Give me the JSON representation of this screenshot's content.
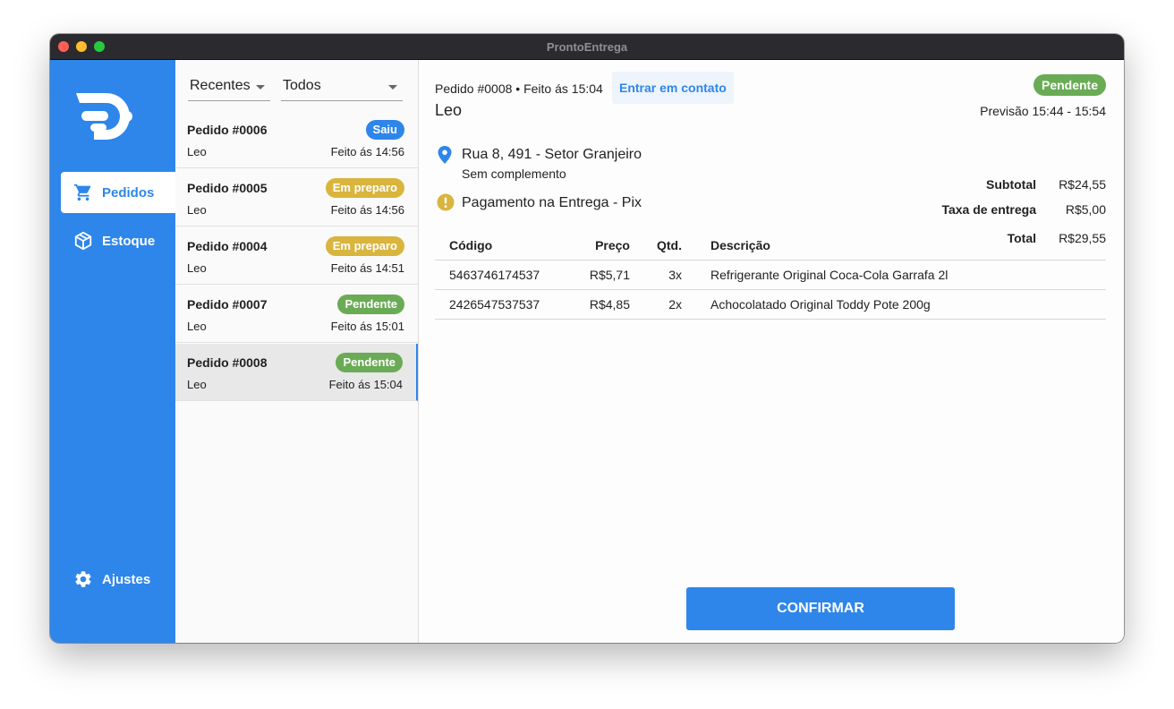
{
  "window": {
    "title": "ProntoEntrega"
  },
  "colors": {
    "brand": "#2e86ea",
    "pendente": "#6aab55",
    "em_preparo": "#d9b53e",
    "saiu": "#2e86ea"
  },
  "sidebar": {
    "logo": "prontoentrega-logo",
    "items": [
      {
        "label": "Pedidos",
        "icon": "cart-icon",
        "active": true
      },
      {
        "label": "Estoque",
        "icon": "box-icon",
        "active": false
      },
      {
        "label": "Ajustes",
        "icon": "gear-icon",
        "active": false
      }
    ]
  },
  "orders": {
    "filters": [
      "Recentes",
      "Todos"
    ],
    "list": [
      {
        "title": "Pedido #0006",
        "status": "Saiu",
        "customer": "Leo",
        "time": "Feito ás 14:56"
      },
      {
        "title": "Pedido #0005",
        "status": "Em preparo",
        "customer": "Leo",
        "time": "Feito ás 14:56"
      },
      {
        "title": "Pedido #0004",
        "status": "Em preparo",
        "customer": "Leo",
        "time": "Feito ás 14:51"
      },
      {
        "title": "Pedido #0007",
        "status": "Pendente",
        "customer": "Leo",
        "time": "Feito ás 15:01"
      },
      {
        "title": "Pedido #0008",
        "status": "Pendente",
        "customer": "Leo",
        "time": "Feito ás 15:04",
        "selected": true
      }
    ]
  },
  "detail": {
    "header": "Pedido #0008 • Feito ás 15:04",
    "contact_button": "Entrar em contato",
    "customer": "Leo",
    "status": "Pendente",
    "forecast": "Previsão 15:44 - 15:54",
    "address": "Rua 8, 491 - Setor Granjeiro",
    "address_complement": "Sem complemento",
    "payment": "Pagamento na Entrega - Pix",
    "summary": {
      "subtotal_label": "Subtotal",
      "subtotal": "R$24,55",
      "fee_label": "Taxa de entrega",
      "fee": "R$5,00",
      "total_label": "Total",
      "total": "R$29,55"
    },
    "table": {
      "headers": [
        "Código",
        "Preço",
        "Qtd.",
        "Descrição"
      ],
      "rows": [
        [
          "5463746174537",
          "R$5,71",
          "3x",
          "Refrigerante Original Coca-Cola Garrafa 2l"
        ],
        [
          "2426547537537",
          "R$4,85",
          "2x",
          "Achocolatado Original Toddy Pote 200g"
        ]
      ]
    },
    "confirm_button": "CONFIRMAR"
  }
}
